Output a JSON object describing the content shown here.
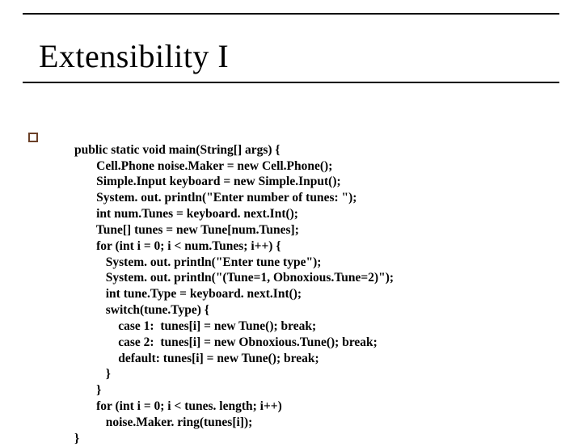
{
  "title": "Extensibility I",
  "code": {
    "l01": "public static void main(String[] args) {",
    "l02": "       Cell.Phone noise.Maker = new Cell.Phone();",
    "l03": "       Simple.Input keyboard = new Simple.Input();",
    "l04": "       System. out. println(\"Enter number of tunes: \");",
    "l05": "       int num.Tunes = keyboard. next.Int();",
    "l06": "       Tune[] tunes = new Tune[num.Tunes];",
    "l07": "       for (int i = 0; i < num.Tunes; i++) {",
    "l08": "          System. out. println(\"Enter tune type\");",
    "l09": "          System. out. println(\"(Tune=1, Obnoxious.Tune=2)\");",
    "l10": "          int tune.Type = keyboard. next.Int();",
    "l11": "          switch(tune.Type) {",
    "l12": "              case 1:  tunes[i] = new Tune(); break;",
    "l13": "              case 2:  tunes[i] = new Obnoxious.Tune(); break;",
    "l14": "              default: tunes[i] = new Tune(); break;",
    "l15": "          }",
    "l16": "       }",
    "l17": "       for (int i = 0; i < tunes. length; i++)",
    "l18": "          noise.Maker. ring(tunes[i]);",
    "l19": "}"
  }
}
